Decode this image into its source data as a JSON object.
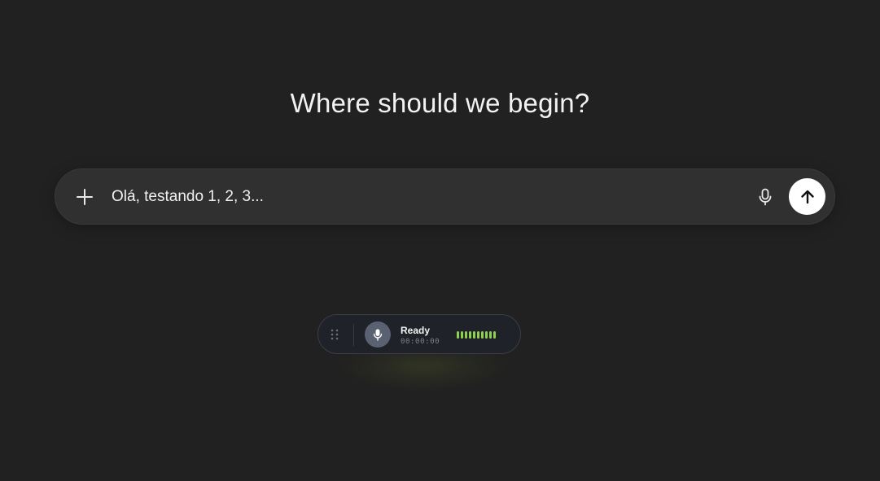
{
  "heading": "Where should we begin?",
  "composer": {
    "value": "Olá, testando 1, 2, 3...",
    "plus_icon": "plus-icon",
    "mic_icon": "microphone-icon",
    "send_icon": "arrow-up-icon"
  },
  "recorder": {
    "status": "Ready",
    "time": "00:00:00",
    "handle_icon": "drag-handle-icon",
    "mic_icon": "microphone-icon",
    "level_bars": 10,
    "level_active": 10,
    "accent_color": "#8fd14f"
  }
}
